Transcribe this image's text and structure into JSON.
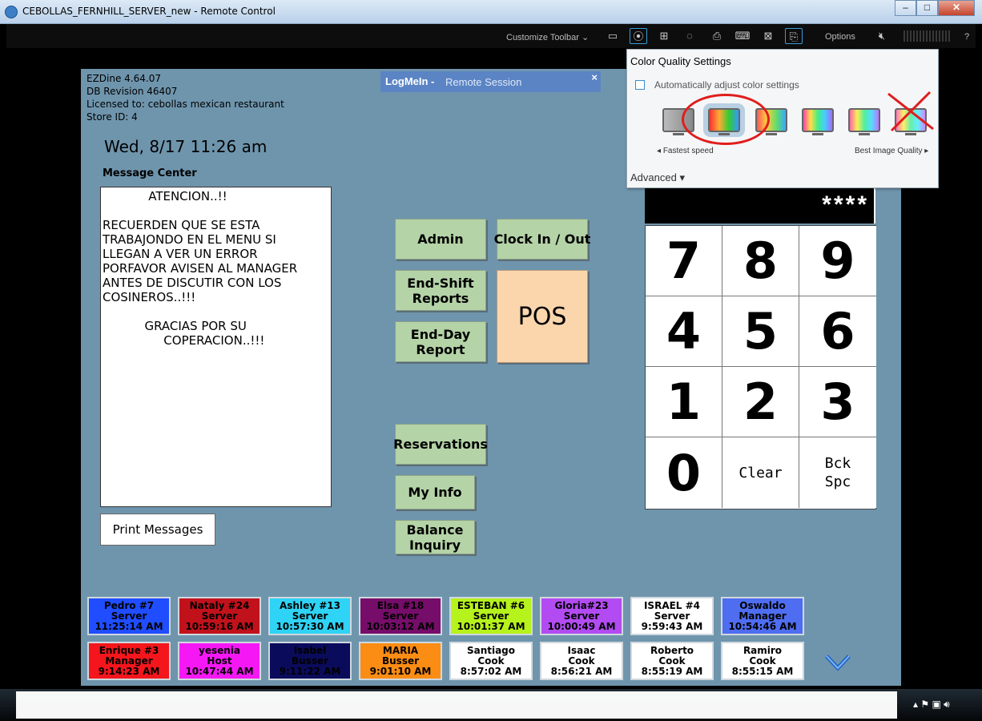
{
  "window": {
    "title": "CEBOLLAS_FERNHILL_SERVER_new - Remote Control",
    "minimize": "–",
    "maximize": "□",
    "close": "✕"
  },
  "toolbar": {
    "customize_label": "Customize Toolbar",
    "options_label": "Options",
    "help_label": "?"
  },
  "logmein": {
    "brand": "LogMeIn -",
    "session": "Remote Session",
    "close": "×"
  },
  "system_info": {
    "line1": "EZDine 4.64.07",
    "line2": "DB Revision 46407",
    "line3": "Licensed to: cebollas mexican restaurant",
    "line4": "Store ID: 4"
  },
  "datetime": "Wed, 8/17 11:26 am",
  "message_center": {
    "title": "Message Center",
    "lines": [
      "            ATENCION..!!",
      "",
      "RECUERDEN QUE SE ESTA",
      "TRABAJONDO EN EL MENU SI",
      "LLEGAN A VER UN ERROR",
      "PORFAVOR AVISEN AL MANAGER",
      "ANTES DE DISCUTIR CON LOS",
      "COSINEROS..!!!",
      "",
      "           GRACIAS POR SU",
      "                COPERACION..!!!"
    ],
    "print_label": "Print Messages"
  },
  "buttons": {
    "admin": "Admin",
    "clock": "Clock In / Out",
    "end_shift": "End-Shift\nReports",
    "end_day": "End-Day\nReport",
    "pos": "POS",
    "reservations": "Reservations",
    "my_info": "My Info",
    "balance": "Balance\nInquiry"
  },
  "keypad": {
    "display": "****",
    "keys": [
      "7",
      "8",
      "9",
      "4",
      "5",
      "6",
      "1",
      "2",
      "3",
      "0",
      "Clear",
      "Bck\nSpc"
    ]
  },
  "employees": [
    {
      "name": "Pedro #7",
      "role": "Server",
      "time": "11:25:14 AM",
      "bg": "#1f4dff",
      "fg": "#000000"
    },
    {
      "name": "Nataly #24",
      "role": "Server",
      "time": "10:59:16 AM",
      "bg": "#c1121c",
      "fg": "#000000"
    },
    {
      "name": "Ashley #13",
      "role": "Server",
      "time": "10:57:30 AM",
      "bg": "#2fd3f5",
      "fg": "#000000"
    },
    {
      "name": "Elsa #18",
      "role": "Server",
      "time": "10:03:12 AM",
      "bg": "#770d6a",
      "fg": "#000000"
    },
    {
      "name": "ESTEBAN #6",
      "role": "Server",
      "time": "10:01:37 AM",
      "bg": "#b6f21b",
      "fg": "#000000"
    },
    {
      "name": "Gloria#23",
      "role": "Server",
      "time": "10:00:49 AM",
      "bg": "#b24cf2",
      "fg": "#000000"
    },
    {
      "name": "ISRAEL #4",
      "role": "Server",
      "time": "9:59:43 AM",
      "bg": "#ffffff",
      "fg": "#000000"
    },
    {
      "name": "Oswaldo",
      "role": "Manager",
      "time": "10:54:46 AM",
      "bg": "#4f6df0",
      "fg": "#000000"
    },
    {
      "name": "Enrique #3",
      "role": "Manager",
      "time": "9:14:23 AM",
      "bg": "#f4161c",
      "fg": "#000000"
    },
    {
      "name": "yesenia",
      "role": "Host",
      "time": "10:47:44 AM",
      "bg": "#f518f5",
      "fg": "#000000"
    },
    {
      "name": "Isabel",
      "role": "Busser",
      "time": "9:11:22 AM",
      "bg": "#0b0b5c",
      "fg": "#000000"
    },
    {
      "name": "MARIA",
      "role": "Busser",
      "time": "9:01:10 AM",
      "bg": "#fb8c14",
      "fg": "#000000"
    },
    {
      "name": "Santiago",
      "role": "Cook",
      "time": "8:57:02 AM",
      "bg": "#ffffff",
      "fg": "#000000"
    },
    {
      "name": "Isaac",
      "role": "Cook",
      "time": "8:56:21 AM",
      "bg": "#ffffff",
      "fg": "#000000"
    },
    {
      "name": "Roberto",
      "role": "Cook",
      "time": "8:55:19 AM",
      "bg": "#ffffff",
      "fg": "#000000"
    },
    {
      "name": "Ramiro",
      "role": "Cook",
      "time": "8:55:15 AM",
      "bg": "#ffffff",
      "fg": "#000000"
    }
  ],
  "color_settings": {
    "title": "Color Quality Settings",
    "auto_label": "Automatically adjust color settings",
    "auto_checked": false,
    "fastest_label": "Fastest speed",
    "best_label": "Best Image Quality",
    "advanced_label": "Advanced",
    "selected_index": 1,
    "options_count": 6
  },
  "colors": {
    "screen_bg": "#6f95ad",
    "button_green": "#b4d3a7",
    "pos_peach": "#fbd6ad",
    "annotation_red": "#e01d1d",
    "popup_accent": "#3a8dd1"
  }
}
